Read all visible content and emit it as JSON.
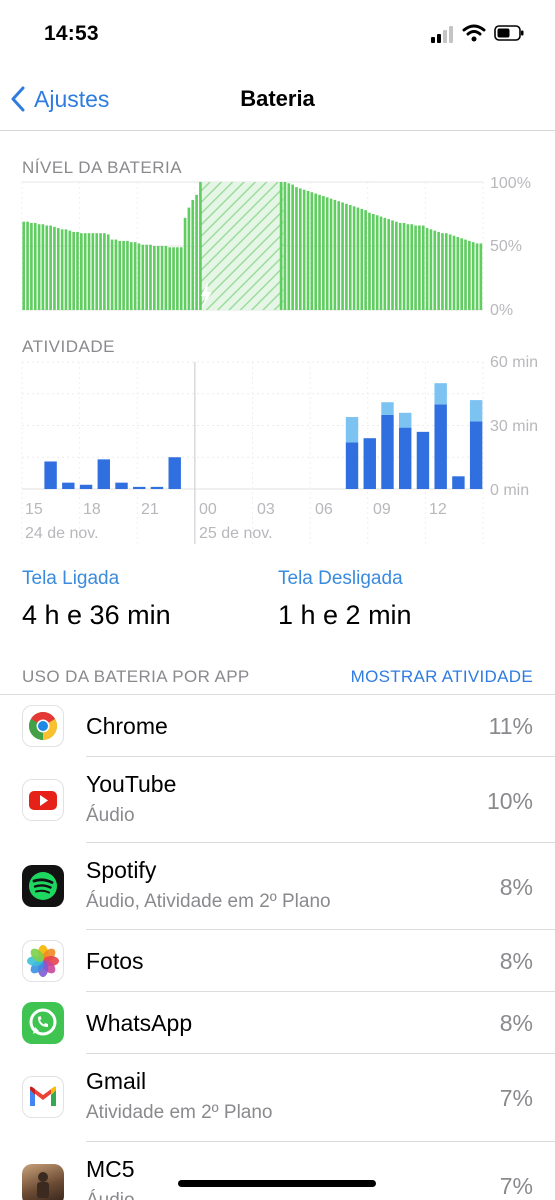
{
  "status_bar": {
    "time": "14:53"
  },
  "nav": {
    "back_label": "Ajustes",
    "title": "Bateria"
  },
  "battery_level": {
    "label": "NÍVEL DA BATERIA",
    "y_ticks": [
      "100%",
      "50%",
      "0%"
    ]
  },
  "activity": {
    "label": "ATIVIDADE",
    "y_ticks": [
      "60 min",
      "30 min",
      "0 min"
    ],
    "x_ticks": [
      "15",
      "18",
      "21",
      "00",
      "03",
      "06",
      "09",
      "12"
    ],
    "date_labels": [
      "24 de nov.",
      "25 de nov."
    ]
  },
  "chart_data": [
    {
      "type": "bar",
      "title": "NÍVEL DA BATERIA",
      "y_unit": "%",
      "ylim": [
        0,
        100
      ],
      "charging_period_index_range": [
        42,
        67
      ],
      "values": [
        69,
        69,
        68,
        68,
        67,
        67,
        66,
        66,
        65,
        64,
        63,
        63,
        62,
        61,
        61,
        60,
        60,
        60,
        60,
        60,
        60,
        60,
        59,
        55,
        55,
        54,
        54,
        54,
        53,
        53,
        52,
        51,
        51,
        51,
        50,
        50,
        50,
        50,
        49,
        49,
        49,
        49,
        72,
        80,
        86,
        90,
        100,
        100,
        100,
        100,
        100,
        100,
        100,
        100,
        100,
        100,
        100,
        100,
        100,
        100,
        100,
        100,
        100,
        100,
        100,
        100,
        100,
        100,
        100,
        99,
        98,
        96,
        95,
        94,
        93,
        92,
        91,
        90,
        89,
        88,
        87,
        86,
        85,
        84,
        83,
        82,
        81,
        80,
        79,
        78,
        76,
        75,
        74,
        73,
        72,
        71,
        70,
        69,
        68,
        68,
        67,
        67,
        66,
        66,
        66,
        64,
        63,
        62,
        61,
        60,
        60,
        59,
        58,
        57,
        56,
        55,
        54,
        53,
        52,
        52
      ]
    },
    {
      "type": "bar",
      "title": "ATIVIDADE",
      "y_unit": "min",
      "ylim": [
        0,
        60
      ],
      "x_tick_labels": [
        "15",
        "18",
        "21",
        "00",
        "03",
        "06",
        "09",
        "12"
      ],
      "series": [
        {
          "name": "Tela Ligada",
          "color": "#2f6fe0",
          "values": [
            0,
            13,
            3,
            2,
            14,
            3,
            1,
            1,
            15,
            0,
            0,
            0,
            0,
            0,
            0,
            0,
            0,
            0,
            22,
            24,
            35,
            29,
            27,
            40,
            6,
            32
          ]
        },
        {
          "name": "Tela Desligada",
          "color": "#7cc3f2",
          "values": [
            0,
            0,
            0,
            0,
            0,
            0,
            0,
            0,
            0,
            0,
            0,
            0,
            0,
            0,
            0,
            0,
            0,
            0,
            12,
            0,
            6,
            7,
            0,
            10,
            0,
            10
          ]
        }
      ]
    }
  ],
  "screen": {
    "on_label": "Tela Ligada",
    "on_value": "4 h e 36 min",
    "off_label": "Tela Desligada",
    "off_value": "1 h e 2 min"
  },
  "usage": {
    "header": "USO DA BATERIA POR APP",
    "action": "MOSTRAR ATIVIDADE",
    "apps": [
      {
        "name": "Chrome",
        "sub": "",
        "pct": "11%",
        "icon": "chrome-icon"
      },
      {
        "name": "YouTube",
        "sub": "Áudio",
        "pct": "10%",
        "icon": "youtube-icon"
      },
      {
        "name": "Spotify",
        "sub": "Áudio, Atividade em 2º Plano",
        "pct": "8%",
        "icon": "spotify-icon"
      },
      {
        "name": "Fotos",
        "sub": "",
        "pct": "8%",
        "icon": "photos-icon"
      },
      {
        "name": "WhatsApp",
        "sub": "",
        "pct": "8%",
        "icon": "whatsapp-icon"
      },
      {
        "name": "Gmail",
        "sub": "Atividade em 2º Plano",
        "pct": "7%",
        "icon": "gmail-icon"
      },
      {
        "name": "MC5",
        "sub": "Áudio",
        "pct": "7%",
        "icon": "mc5-icon"
      }
    ]
  },
  "colors": {
    "accent": "#2f7ce0",
    "battery_green": "#5fcd5f",
    "activity_dark": "#2f6fe0",
    "activity_light": "#7cc3f2",
    "secondary_text": "#8a8a8e"
  }
}
